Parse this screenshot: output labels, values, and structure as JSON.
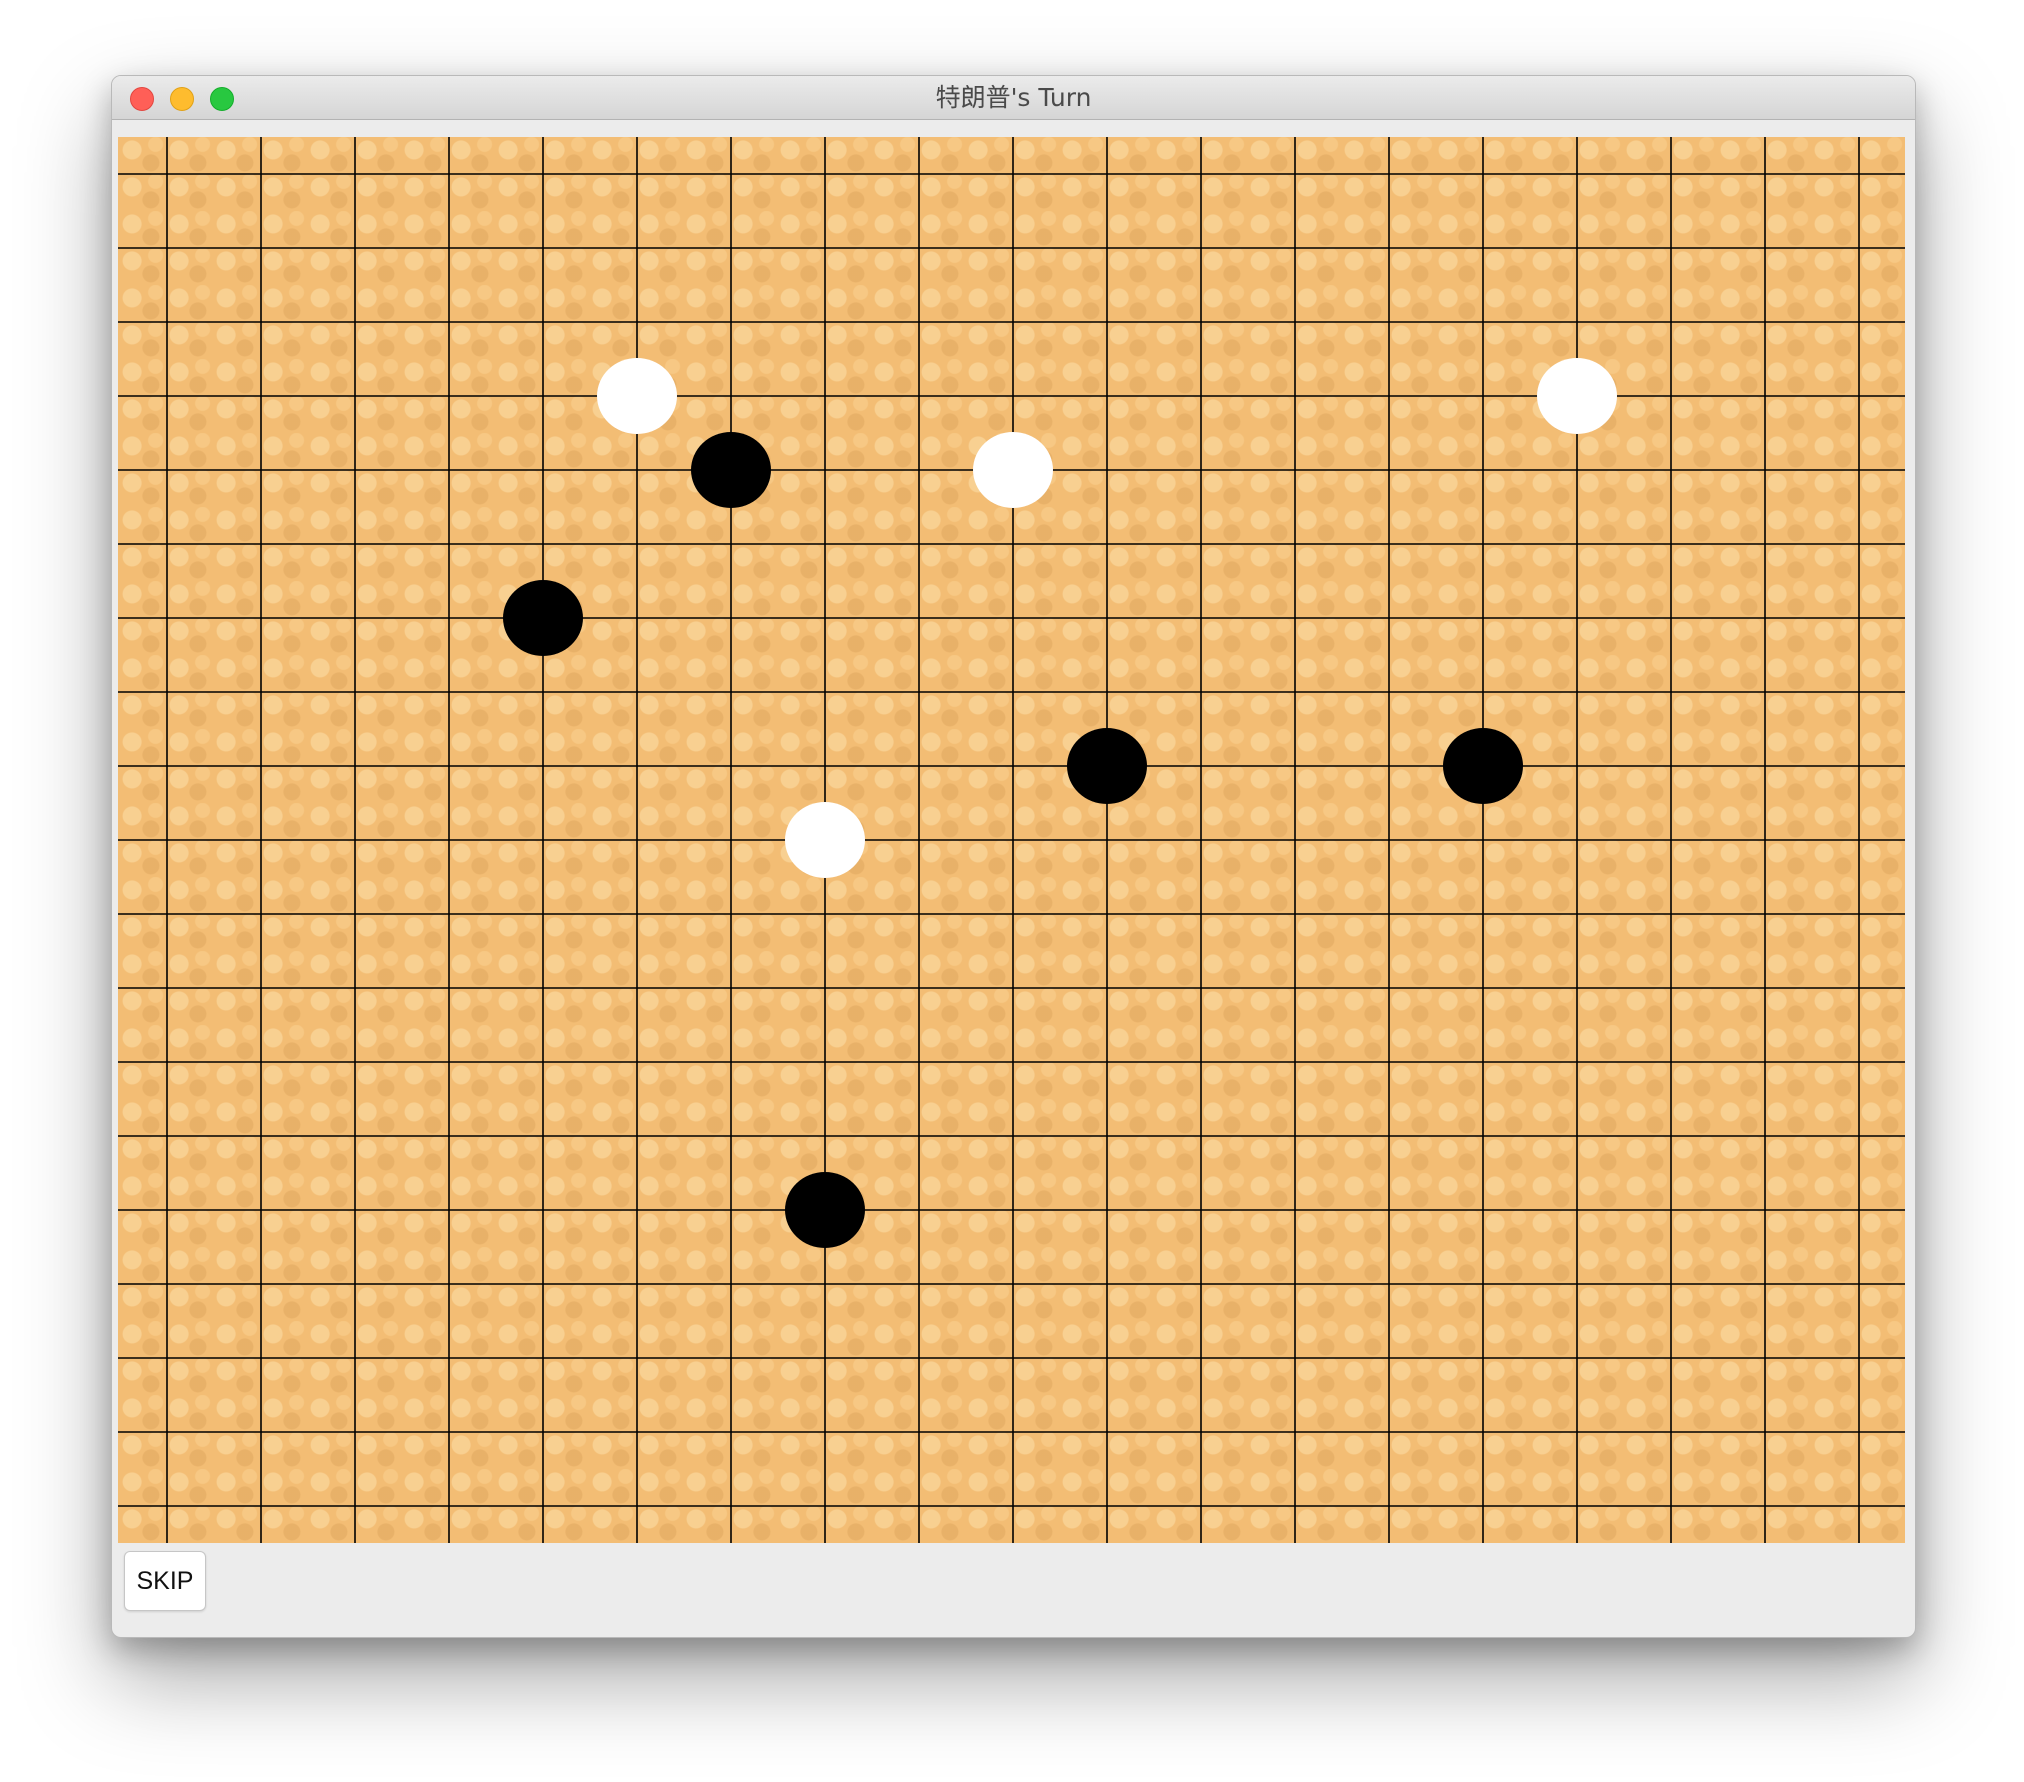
{
  "window": {
    "title": "特朗普's Turn"
  },
  "controls": {
    "skip_label": "SKIP"
  },
  "board": {
    "columns": 19,
    "rows": 19,
    "colors": {
      "wood": "#f3bd74",
      "line": "#000000",
      "black_stone": "#000000",
      "white_stone": "#ffffff"
    },
    "stones": [
      {
        "color": "white",
        "col": 5,
        "row": 3
      },
      {
        "color": "black",
        "col": 6,
        "row": 4
      },
      {
        "color": "white",
        "col": 9,
        "row": 4
      },
      {
        "color": "white",
        "col": 15,
        "row": 3
      },
      {
        "color": "black",
        "col": 4,
        "row": 6
      },
      {
        "color": "black",
        "col": 10,
        "row": 8
      },
      {
        "color": "black",
        "col": 14,
        "row": 8
      },
      {
        "color": "white",
        "col": 7,
        "row": 9
      },
      {
        "color": "black",
        "col": 7,
        "row": 14
      }
    ]
  }
}
